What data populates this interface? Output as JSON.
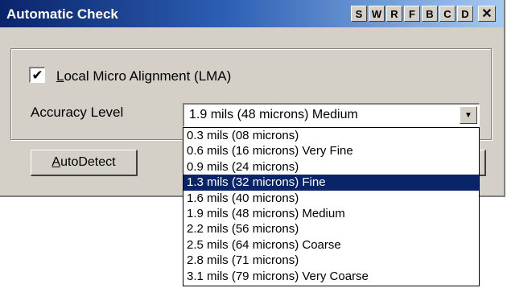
{
  "window": {
    "title": "Automatic Check",
    "titlebar_buttons": [
      "S",
      "W",
      "R",
      "F",
      "B",
      "C",
      "D"
    ],
    "close_glyph": "✕"
  },
  "lma": {
    "checked": true,
    "checkmark": "✔",
    "label": "Local Micro Alignment (LMA)"
  },
  "accuracy": {
    "label": "Accuracy Level",
    "selected_value": "1.9 mils (48 microns) Medium",
    "arrow_glyph": "▼",
    "options": [
      "0.3 mils (08 microns)",
      "0.6 mils (16 microns) Very Fine",
      "0.9 mils (24 microns)",
      "1.3 mils (32 microns) Fine",
      "1.6 mils (40 microns)",
      "1.9 mils (48 microns) Medium",
      "2.2 mils (56 microns)",
      "2.5 mils (64 microns) Coarse",
      "2.8 mils (71 microns)",
      "3.1 mils (79 microns) Very Coarse"
    ],
    "highlighted_option_index": 3
  },
  "buttons": {
    "autodetect_accel": "A",
    "autodetect_rest": "utoDetect"
  },
  "colors": {
    "titlebar_start": "#0a246a",
    "titlebar_end": "#a6caf0",
    "face": "#d4d0c8",
    "highlight": "#0a246a"
  }
}
